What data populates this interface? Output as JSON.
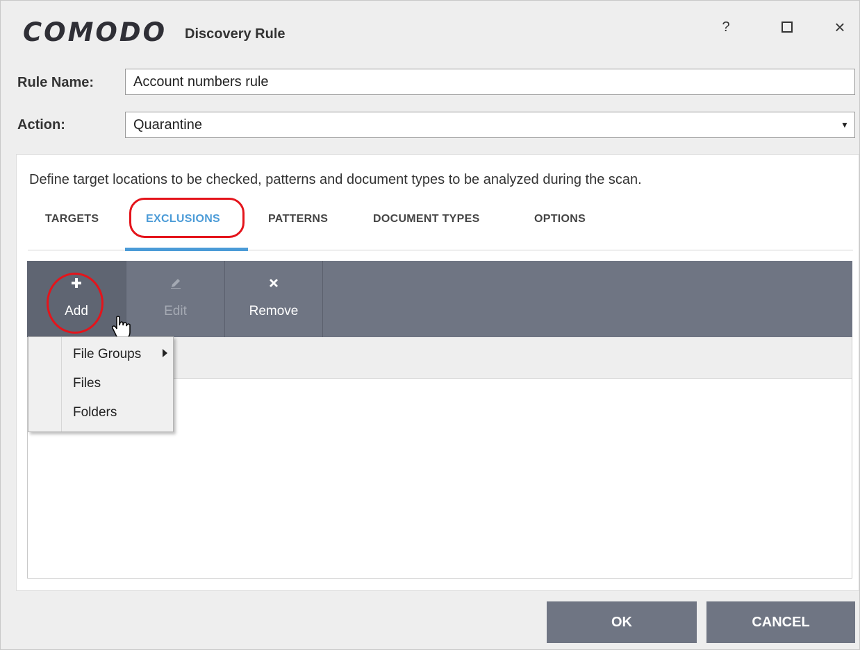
{
  "window": {
    "brand": "COMODO",
    "title": "Discovery Rule",
    "help_label": "?",
    "close_label": "×"
  },
  "form": {
    "rule_name_label": "Rule Name:",
    "rule_name_value": "Account numbers rule",
    "action_label": "Action:",
    "action_value": "Quarantine"
  },
  "panel": {
    "description": "Define target locations to be checked, patterns and document types to be analyzed during the scan.",
    "tabs": [
      {
        "label": "TARGETS"
      },
      {
        "label": "EXCLUSIONS",
        "active": true
      },
      {
        "label": "PATTERNS"
      },
      {
        "label": "DOCUMENT TYPES"
      },
      {
        "label": "OPTIONS"
      }
    ]
  },
  "toolbar": {
    "add_label": "Add",
    "edit_label": "Edit",
    "remove_label": "Remove"
  },
  "menu": {
    "items": [
      {
        "label": "File Groups",
        "has_submenu": true
      },
      {
        "label": "Files"
      },
      {
        "label": "Folders"
      }
    ]
  },
  "footer": {
    "ok_label": "OK",
    "cancel_label": "CANCEL"
  },
  "colors": {
    "accent": "#4b9bd7",
    "toolbar": "#6f7583",
    "highlight": "#e4141b"
  }
}
